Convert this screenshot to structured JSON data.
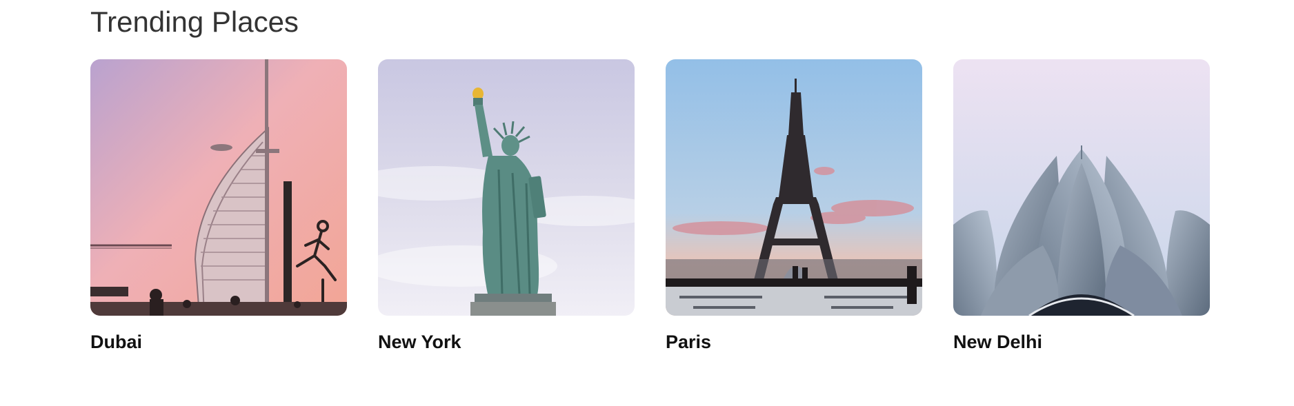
{
  "section": {
    "title": "Trending Places"
  },
  "places": [
    {
      "name": "Dubai",
      "image_icon": "burj-al-arab-photo"
    },
    {
      "name": "New York",
      "image_icon": "statue-of-liberty-photo"
    },
    {
      "name": "Paris",
      "image_icon": "eiffel-tower-photo"
    },
    {
      "name": "New Delhi",
      "image_icon": "lotus-temple-photo"
    }
  ],
  "colors": {
    "title_text": "#333333",
    "card_text": "#111111",
    "background": "#ffffff"
  }
}
